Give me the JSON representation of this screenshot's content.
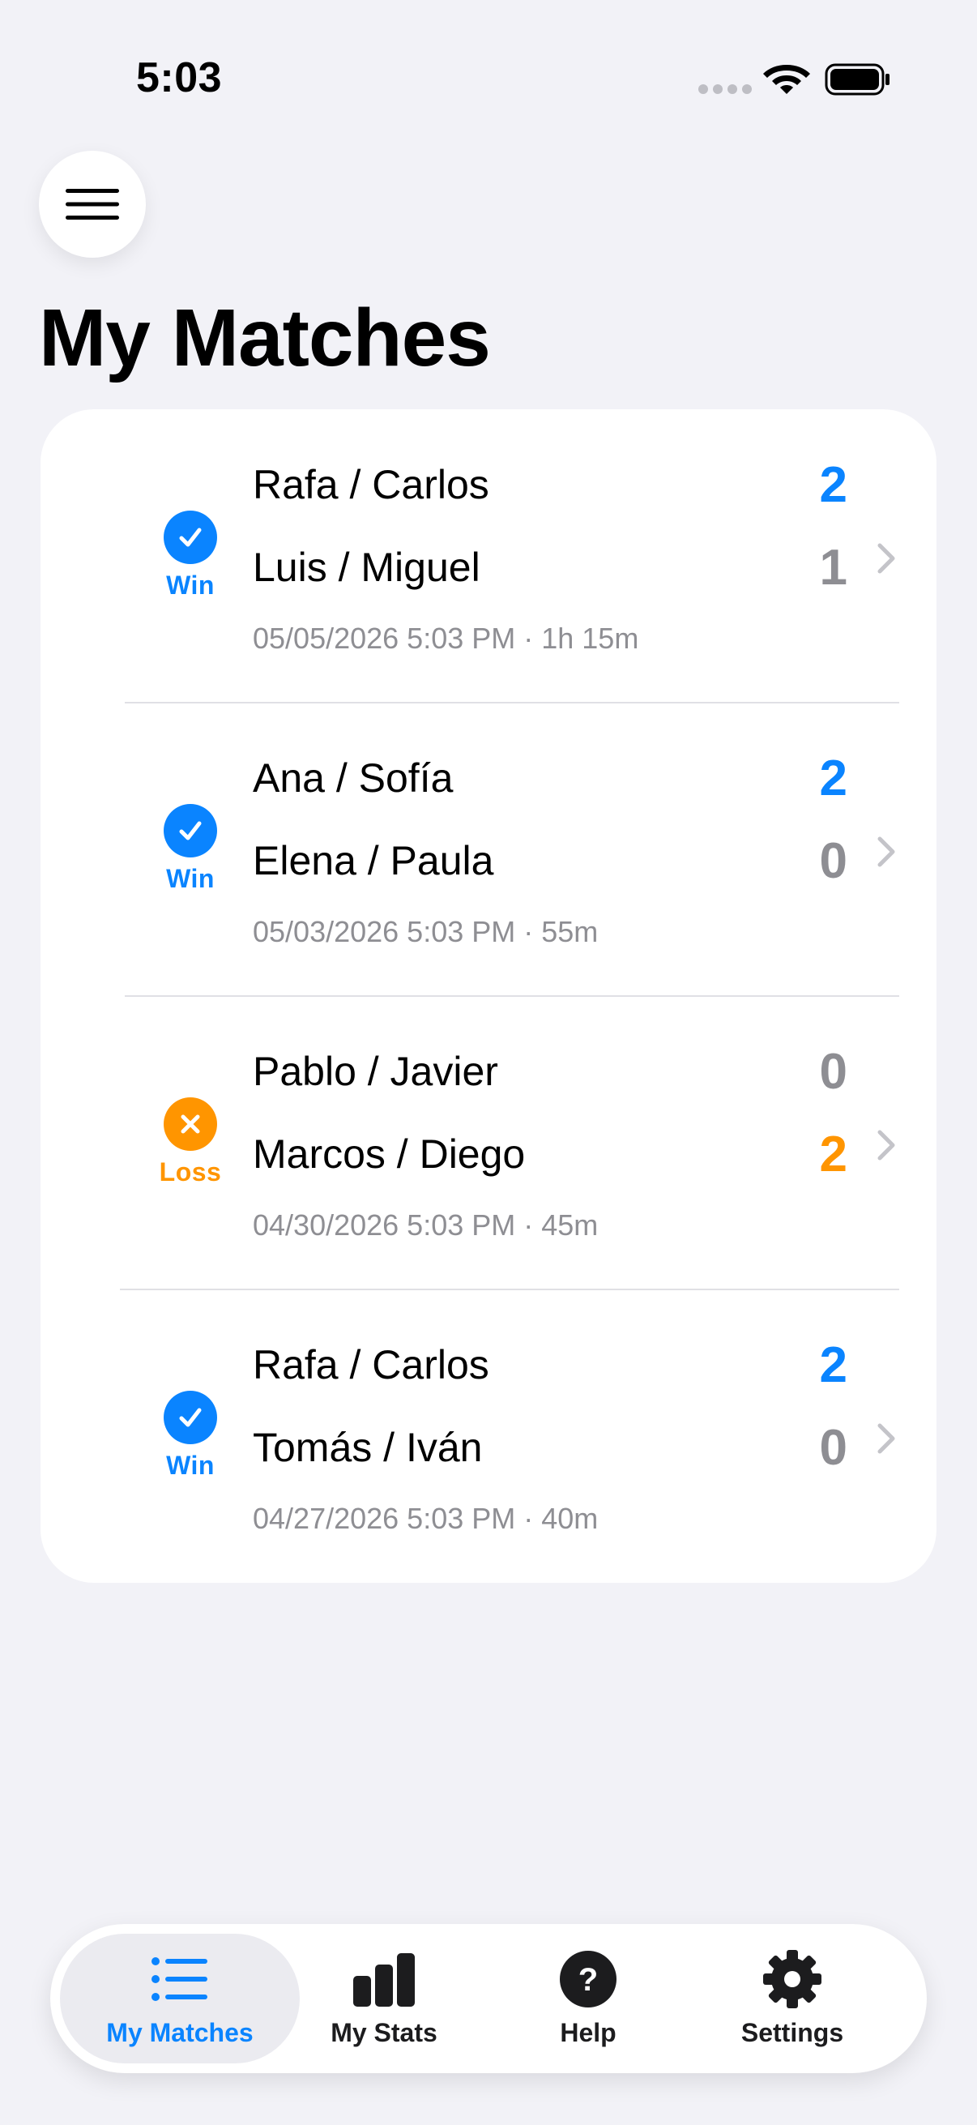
{
  "status_bar": {
    "time": "5:03"
  },
  "page": {
    "title": "My Matches"
  },
  "matches": [
    {
      "result": "Win",
      "team1": "Rafa / Carlos",
      "score1": "2",
      "team2": "Luis / Miguel",
      "score2": "1",
      "meta": "05/05/2026 5:03 PM · 1h 15m"
    },
    {
      "result": "Win",
      "team1": "Ana / Sofía",
      "score1": "2",
      "team2": "Elena / Paula",
      "score2": "0",
      "meta": "05/03/2026 5:03 PM · 55m"
    },
    {
      "result": "Loss",
      "team1": "Pablo / Javier",
      "score1": "0",
      "team2": "Marcos / Diego",
      "score2": "2",
      "meta": "04/30/2026 5:03 PM · 45m"
    },
    {
      "result": "Win",
      "team1": "Rafa / Carlos",
      "score1": "2",
      "team2": "Tomás / Iván",
      "score2": "0",
      "meta": "04/27/2026 5:03 PM · 40m"
    }
  ],
  "tab_bar": {
    "tabs": [
      {
        "label": "My Matches",
        "icon": "list-icon",
        "active": true
      },
      {
        "label": "My Stats",
        "icon": "bar-chart-icon",
        "active": false
      },
      {
        "label": "Help",
        "icon": "question-circle-icon",
        "active": false
      },
      {
        "label": "Settings",
        "icon": "gear-icon",
        "active": false
      }
    ]
  },
  "colors": {
    "accent": "#0A84FF",
    "loss": "#FF9500",
    "secondary_text": "#8E8E93",
    "background": "#F2F2F7"
  }
}
